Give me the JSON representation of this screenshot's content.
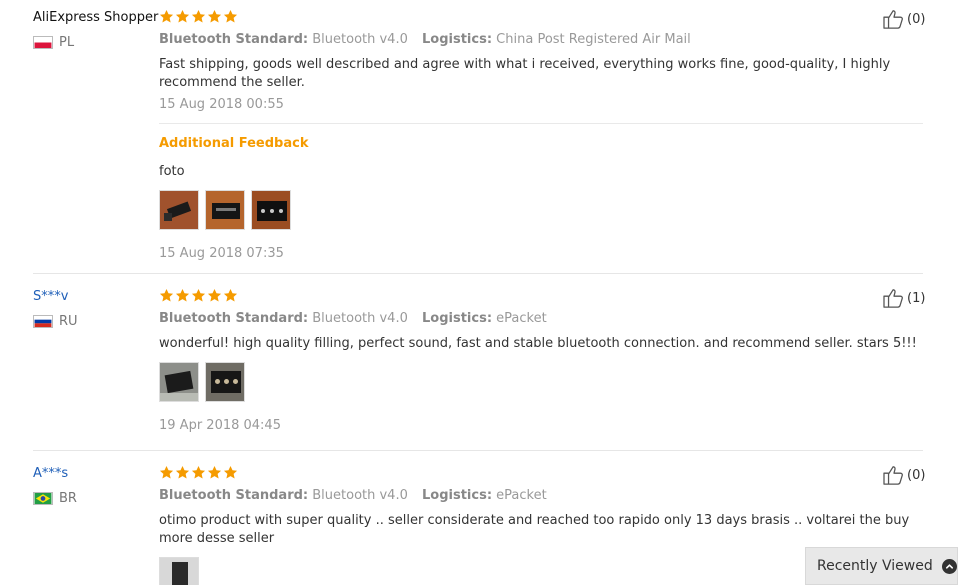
{
  "reviews": [
    {
      "username": "AliExpress Shopper",
      "country": "PL",
      "likes": "(0)",
      "prop1_key": "Bluetooth Standard:",
      "prop1_val": "Bluetooth v4.0",
      "prop2_key": "Logistics:",
      "prop2_val": "China Post Registered Air Mail",
      "text": "Fast shipping, goods well described and agree with what i received, everything works fine, good-quality, I highly recommend the seller.",
      "date": "15 Aug 2018 00:55",
      "additional_title": "Additional Feedback",
      "additional_text": "foto",
      "additional_date": "15 Aug 2018 07:35",
      "rating": 5
    },
    {
      "username": "S***v",
      "country": "RU",
      "likes": "(1)",
      "prop1_key": "Bluetooth Standard:",
      "prop1_val": "Bluetooth v4.0",
      "prop2_key": "Logistics:",
      "prop2_val": "ePacket",
      "text": "wonderful! high quality filling, perfect sound, fast and stable bluetooth connection. and recommend seller. stars 5!!!",
      "date": "19 Apr 2018 04:45",
      "rating": 5
    },
    {
      "username": "A***s",
      "country": "BR",
      "likes": "(0)",
      "prop1_key": "Bluetooth Standard:",
      "prop1_val": "Bluetooth v4.0",
      "prop2_key": "Logistics:",
      "prop2_val": "ePacket",
      "text": "otimo product with super quality .. seller considerate and reached too rapido only 13 days brasis .. voltarei the buy more desse seller",
      "rating": 5
    }
  ],
  "recently_viewed": "Recently Viewed",
  "colors": {
    "star": "#f59b00",
    "accent": "#f59b00",
    "link": "#1f5fb8"
  },
  "icons": [
    "star-icon",
    "thumbs-up-icon",
    "chevron-up-icon",
    "flag-pl-icon",
    "flag-ru-icon",
    "flag-br-icon"
  ]
}
